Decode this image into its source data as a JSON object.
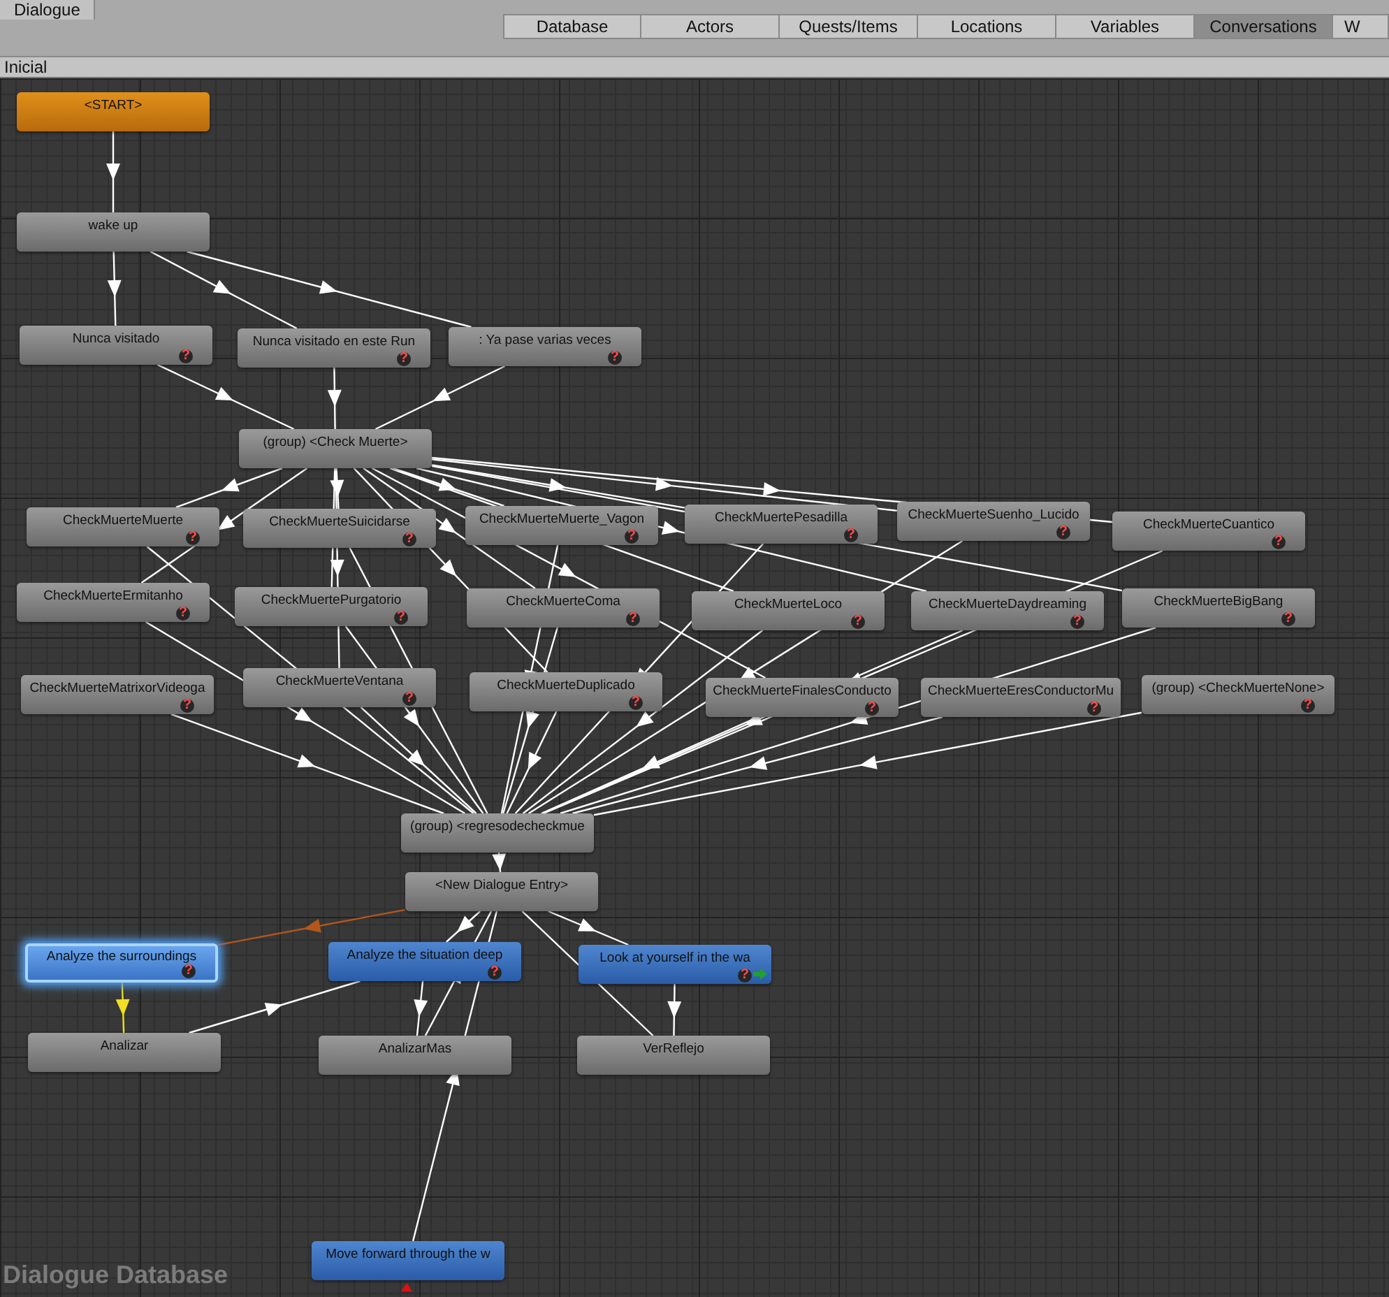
{
  "window": {
    "title": "Dialogue"
  },
  "tabs": [
    {
      "label": "Database",
      "selected": false
    },
    {
      "label": "Actors",
      "selected": false
    },
    {
      "label": "Quests/Items",
      "selected": false
    },
    {
      "label": "Locations",
      "selected": false
    },
    {
      "label": "Variables",
      "selected": false
    },
    {
      "label": "Conversations",
      "selected": true
    },
    {
      "label": "W",
      "selected": false
    }
  ],
  "conversation": {
    "title": "Inicial"
  },
  "nodes": [
    {
      "title": "<START>",
      "kind": "start",
      "selected": false,
      "arrow": false
    },
    {
      "title": "wake up",
      "kind": "npc",
      "selected": false,
      "arrow": false
    },
    {
      "title": "Nunca visitado",
      "kind": "npc",
      "selected": false,
      "condition_mark": "?",
      "arrow": false
    },
    {
      "title": "Nunca visitado en este Run",
      "kind": "npc",
      "selected": false,
      "condition_mark": "?",
      "arrow": false
    },
    {
      "title": ": Ya pase varias veces",
      "kind": "npc",
      "selected": false,
      "condition_mark": "?",
      "arrow": false
    },
    {
      "title": "(group) <Check Muerte>",
      "kind": "npc",
      "selected": false,
      "arrow": false
    },
    {
      "title": "CheckMuerteMuerte",
      "kind": "npc",
      "selected": false,
      "condition_mark": "?",
      "arrow": false
    },
    {
      "title": "CheckMuerteSuicidarse",
      "kind": "npc",
      "selected": false,
      "condition_mark": "?",
      "arrow": false
    },
    {
      "title": "CheckMuerteMuerte_Vagon",
      "kind": "npc",
      "selected": false,
      "condition_mark": "?",
      "arrow": false
    },
    {
      "title": "CheckMuertePesadilla",
      "kind": "npc",
      "selected": false,
      "condition_mark": "?",
      "arrow": false
    },
    {
      "title": "CheckMuerteSuenho_Lucido",
      "kind": "npc",
      "selected": false,
      "condition_mark": "?",
      "arrow": false
    },
    {
      "title": "CheckMuerteCuantico",
      "kind": "npc",
      "selected": false,
      "condition_mark": "?",
      "arrow": false
    },
    {
      "title": "CheckMuerteErmitanho",
      "kind": "npc",
      "selected": false,
      "condition_mark": "?",
      "arrow": false
    },
    {
      "title": "CheckMuertePurgatorio",
      "kind": "npc",
      "selected": false,
      "condition_mark": "?",
      "arrow": false
    },
    {
      "title": "CheckMuerteComa",
      "kind": "npc",
      "selected": false,
      "condition_mark": "?",
      "arrow": false
    },
    {
      "title": "CheckMuerteLoco",
      "kind": "npc",
      "selected": false,
      "condition_mark": "?",
      "arrow": false
    },
    {
      "title": "CheckMuerteDaydreaming",
      "kind": "npc",
      "selected": false,
      "condition_mark": "?",
      "arrow": false
    },
    {
      "title": "CheckMuerteBigBang",
      "kind": "npc",
      "selected": false,
      "condition_mark": "?",
      "arrow": false
    },
    {
      "title": "CheckMuerteMatrixorVideoga",
      "kind": "npc",
      "selected": false,
      "condition_mark": "?",
      "arrow": false
    },
    {
      "title": "CheckMuerteVentana",
      "kind": "npc",
      "selected": false,
      "condition_mark": "?",
      "arrow": false
    },
    {
      "title": "CheckMuerteDuplicado",
      "kind": "npc",
      "selected": false,
      "condition_mark": "?",
      "arrow": false
    },
    {
      "title": "CheckMuerteFinalesConducto",
      "kind": "npc",
      "selected": false,
      "condition_mark": "?",
      "arrow": false
    },
    {
      "title": "CheckMuerteEresConductorMu",
      "kind": "npc",
      "selected": false,
      "condition_mark": "?",
      "arrow": false
    },
    {
      "title": "(group) <CheckMuerteNone>",
      "kind": "npc",
      "selected": false,
      "condition_mark": "?",
      "arrow": false
    },
    {
      "title": "(group) <regresodecheckmue",
      "kind": "npc",
      "selected": false,
      "arrow": false
    },
    {
      "title": "<New Dialogue Entry>",
      "kind": "npc",
      "selected": false,
      "arrow": false
    },
    {
      "title": "Analyze the surroundings",
      "kind": "player",
      "selected": true,
      "condition_mark": "?",
      "arrow": false
    },
    {
      "title": "Analyze the situation deep",
      "kind": "player",
      "selected": false,
      "condition_mark": "?",
      "arrow": false
    },
    {
      "title": "Look at yourself in the wa",
      "kind": "player",
      "selected": false,
      "condition_mark": "?",
      "arrow": true
    },
    {
      "title": "Analizar",
      "kind": "npc",
      "selected": false,
      "arrow": false
    },
    {
      "title": "AnalizarMas",
      "kind": "npc",
      "selected": false,
      "arrow": false
    },
    {
      "title": "VerReflejo",
      "kind": "npc",
      "selected": false,
      "arrow": false
    },
    {
      "title": "Move forward through the w",
      "kind": "player",
      "selected": false,
      "arrow": false
    }
  ],
  "canvas_label": "Dialogue Database"
}
